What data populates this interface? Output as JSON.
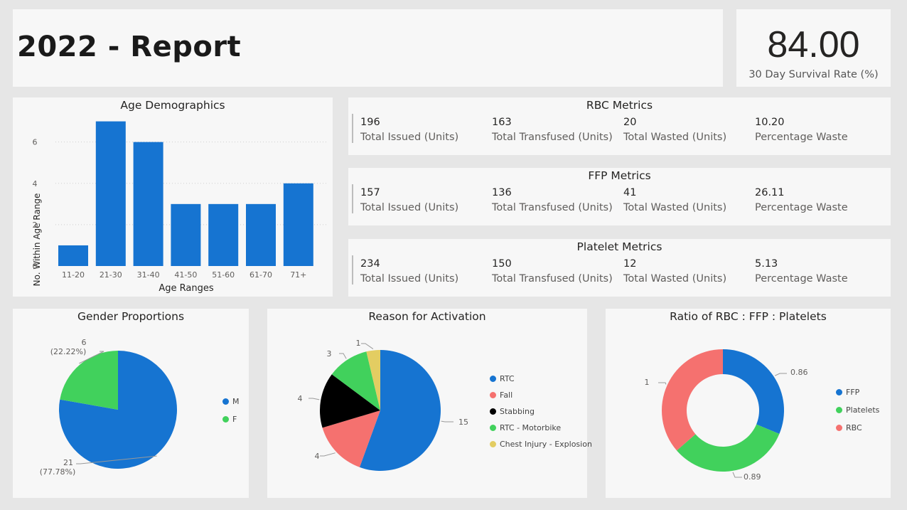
{
  "report_title": "2022 - Report",
  "kpi": {
    "value": "84.00",
    "label": "30 Day Survival Rate (%)"
  },
  "metrics": [
    {
      "title": "RBC Metrics",
      "items": [
        {
          "value": "196",
          "label": "Total Issued (Units)"
        },
        {
          "value": "163",
          "label": "Total Transfused (Units)"
        },
        {
          "value": "20",
          "label": "Total Wasted (Units)"
        },
        {
          "value": "10.20",
          "label": "Percentage Waste"
        }
      ]
    },
    {
      "title": "FFP Metrics",
      "items": [
        {
          "value": "157",
          "label": "Total Issued (Units)"
        },
        {
          "value": "136",
          "label": "Total Transfused (Units)"
        },
        {
          "value": "41",
          "label": "Total Wasted (Units)"
        },
        {
          "value": "26.11",
          "label": "Percentage Waste"
        }
      ]
    },
    {
      "title": "Platelet Metrics",
      "items": [
        {
          "value": "234",
          "label": "Total Issued (Units)"
        },
        {
          "value": "150",
          "label": "Total Transfused (Units)"
        },
        {
          "value": "12",
          "label": "Total Wasted (Units)"
        },
        {
          "value": "5.13",
          "label": "Percentage Waste"
        }
      ]
    }
  ],
  "colors": {
    "blue": "#1674d1",
    "green": "#41d15c",
    "red": "#f5716f",
    "black": "#000000",
    "yellow": "#e3cd62"
  },
  "chart_data": [
    {
      "type": "bar",
      "title": "Age Demographics",
      "xlabel": "Age Ranges",
      "ylabel": "No. Within Age Range",
      "categories": [
        "11-20",
        "21-30",
        "31-40",
        "41-50",
        "51-60",
        "61-70",
        "71+"
      ],
      "values": [
        1,
        7,
        6,
        3,
        3,
        3,
        4
      ],
      "ylim": [
        0,
        7.4
      ],
      "yticks": [
        0,
        2,
        4,
        6
      ],
      "grid": true,
      "color": "#1674d1"
    },
    {
      "type": "pie",
      "title": "Gender Proportions",
      "slices": [
        {
          "name": "M",
          "value": 21,
          "label": "21",
          "pct": "(77.78%)",
          "color": "#1674d1"
        },
        {
          "name": "F",
          "value": 6,
          "label": "6",
          "pct": "(22.22%)",
          "color": "#41d15c"
        }
      ],
      "legend": "right"
    },
    {
      "type": "pie",
      "title": "Reason for Activation",
      "slices": [
        {
          "name": "RTC",
          "value": 15,
          "label": "15",
          "color": "#1674d1"
        },
        {
          "name": "Fall",
          "value": 4,
          "label": "4",
          "color": "#f5716f"
        },
        {
          "name": "Stabbing",
          "value": 4,
          "label": "4",
          "color": "#000000"
        },
        {
          "name": "RTC - Motorbike",
          "value": 3,
          "label": "3",
          "color": "#41d15c"
        },
        {
          "name": "Chest Injury - Explosion",
          "value": 1,
          "label": "1",
          "color": "#e3cd62"
        }
      ],
      "legend": "right"
    },
    {
      "type": "pie",
      "title": "Ratio of RBC : FFP : Platelets",
      "donut": true,
      "slices": [
        {
          "name": "FFP",
          "value": 0.86,
          "label": "0.86",
          "color": "#1674d1"
        },
        {
          "name": "Platelets",
          "value": 0.89,
          "label": "0.89",
          "color": "#41d15c"
        },
        {
          "name": "RBC",
          "value": 1,
          "label": "1",
          "color": "#f5716f"
        }
      ],
      "legend": "right"
    }
  ]
}
